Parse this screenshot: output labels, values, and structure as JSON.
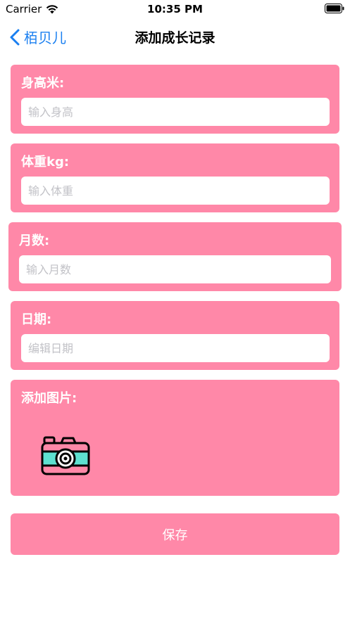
{
  "status_bar": {
    "carrier": "Carrier",
    "time": "10:35 PM",
    "wifi_icon": "wifi-icon",
    "battery_icon": "battery-icon"
  },
  "nav": {
    "back_label": "栢贝儿",
    "title": "添加成长记录",
    "back_icon": "chevron-left-icon"
  },
  "form": {
    "height": {
      "label": "身高米:",
      "placeholder": "输入身高",
      "value": ""
    },
    "weight": {
      "label": "体重kg:",
      "placeholder": "输入体重",
      "value": ""
    },
    "months": {
      "label": "月数:",
      "placeholder": "输入月数",
      "value": ""
    },
    "date": {
      "label": "日期:",
      "placeholder": "编辑日期",
      "value": ""
    },
    "image": {
      "label": "添加图片:",
      "icon": "camera-icon"
    }
  },
  "save_label": "保存",
  "colors": {
    "card": "#ff88a8",
    "accent": "#1a7ff0",
    "camera_lens": "#5ee0d0",
    "camera_body": "#ff88a8"
  }
}
